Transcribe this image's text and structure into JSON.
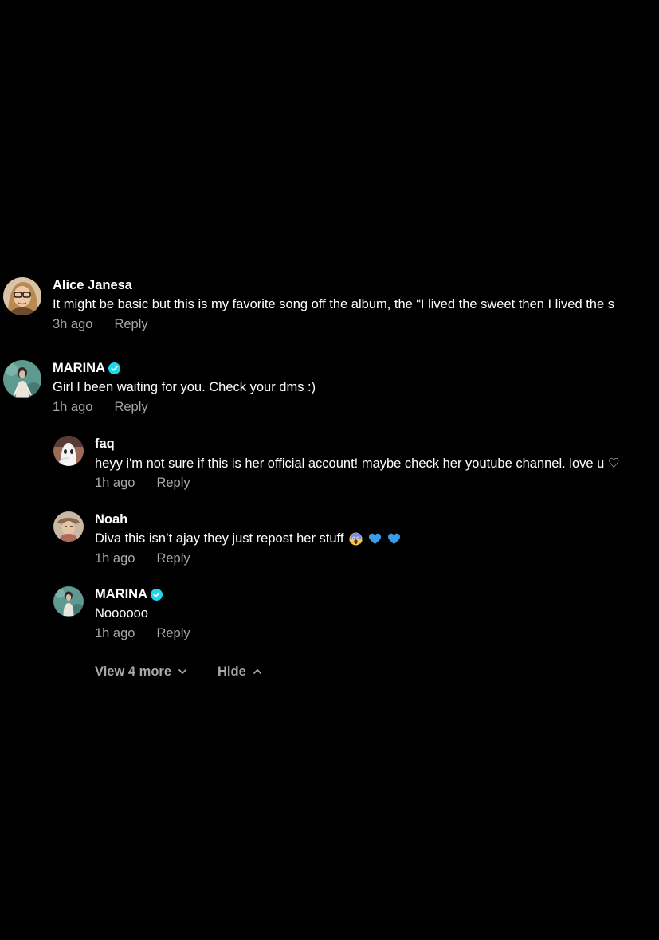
{
  "colors": {
    "background": "#000000",
    "text_primary": "#ffffff",
    "text_secondary": "#a8a8a8",
    "verified": "#20d5ec"
  },
  "comments": [
    {
      "author": "Alice Janesa",
      "verified": false,
      "text": "It might be basic but this is my favorite song off the album, the “I lived the sweet then I lived the s",
      "time": "3h ago",
      "reply_label": "Reply",
      "avatar_icon": "avatar-alice-janesa"
    },
    {
      "author": "MARINA",
      "verified": true,
      "text": "Girl I been waiting for you. Check your dms :)",
      "time": "1h ago",
      "reply_label": "Reply",
      "avatar_icon": "avatar-marina"
    }
  ],
  "replies": [
    {
      "author": "faq",
      "verified": false,
      "text": "heyy i'm not sure if this is her official account! maybe check her youtube channel. love u ♡",
      "time": "1h ago",
      "reply_label": "Reply",
      "avatar_icon": "avatar-faq"
    },
    {
      "author": "Noah",
      "verified": false,
      "text": "Diva this isn’t ajay they just repost her stuff",
      "emojis": [
        "screaming-face-emoji",
        "blue-heart-emoji",
        "blue-heart-emoji"
      ],
      "time": "1h ago",
      "reply_label": "Reply",
      "avatar_icon": "avatar-noah"
    },
    {
      "author": "MARINA",
      "verified": true,
      "text": "Noooooo",
      "time": "1h ago",
      "reply_label": "Reply",
      "avatar_icon": "avatar-marina"
    }
  ],
  "thread_controls": {
    "view_more_label": "View 4 more",
    "view_more_icon": "chevron-down-icon",
    "hide_label": "Hide",
    "hide_icon": "chevron-up-icon"
  }
}
